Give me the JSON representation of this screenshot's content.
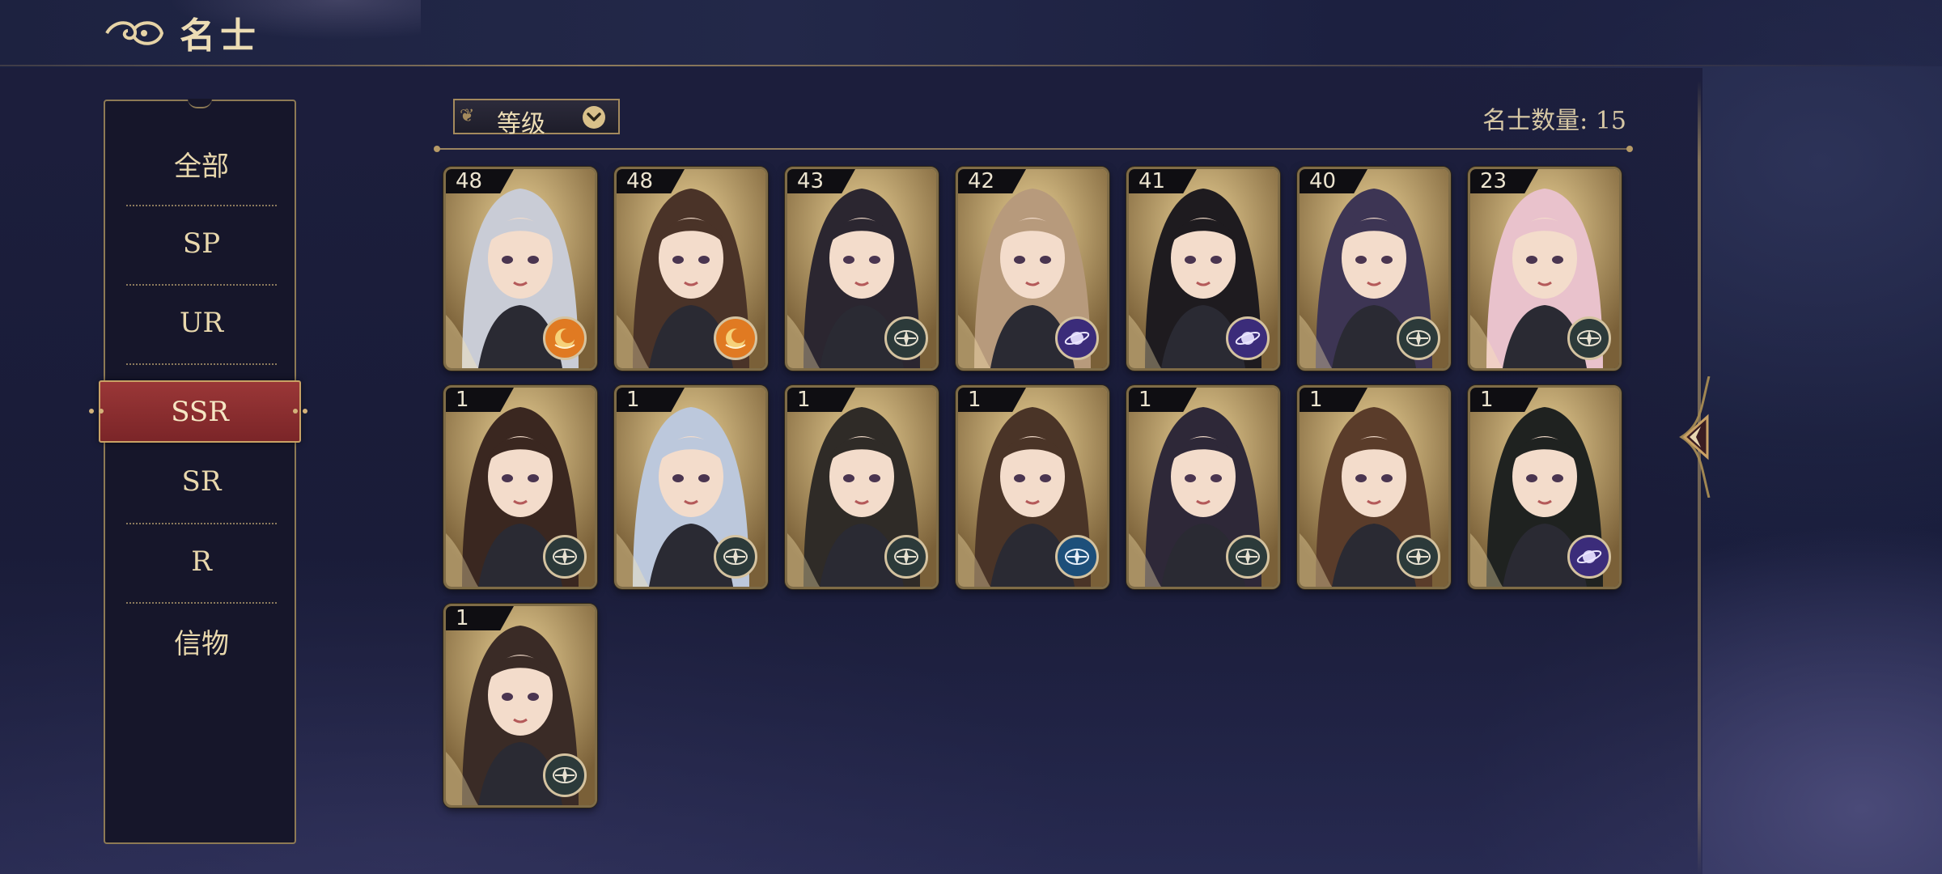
{
  "header": {
    "title": "名士",
    "icon": "cloud-swirl-icon"
  },
  "sidebar": {
    "items": [
      {
        "label": "全部"
      },
      {
        "label": "SP"
      },
      {
        "label": "UR"
      },
      {
        "label": "SSR",
        "active": true
      },
      {
        "label": "SR"
      },
      {
        "label": "R"
      },
      {
        "label": "信物"
      }
    ]
  },
  "toolbar": {
    "sort_label": "等级",
    "count_text": "名士数量: 15"
  },
  "colors": {
    "accent_gold": "#c9a165",
    "active_red": "#8a2d30",
    "text_cream": "#ecdcb4"
  },
  "cards": [
    {
      "level": "48",
      "role_icon": "sun-moon-emblem-icon"
    },
    {
      "level": "48",
      "role_icon": "sun-moon-emblem-icon"
    },
    {
      "level": "43",
      "role_icon": "compass-star-icon"
    },
    {
      "level": "42",
      "role_icon": "planet-emblem-icon"
    },
    {
      "level": "41",
      "role_icon": "planet-emblem-icon"
    },
    {
      "level": "40",
      "role_icon": "compass-star-icon"
    },
    {
      "level": "23",
      "role_icon": "compass-star-icon"
    },
    {
      "level": "1",
      "role_icon": "compass-star-icon"
    },
    {
      "level": "1",
      "role_icon": "compass-star-icon"
    },
    {
      "level": "1",
      "role_icon": "compass-star-icon"
    },
    {
      "level": "1",
      "role_icon": "blue-compass-icon"
    },
    {
      "level": "1",
      "role_icon": "compass-star-icon"
    },
    {
      "level": "1",
      "role_icon": "compass-star-icon"
    },
    {
      "level": "1",
      "role_icon": "planet-emblem-icon"
    },
    {
      "level": "1",
      "role_icon": "compass-star-icon"
    }
  ]
}
